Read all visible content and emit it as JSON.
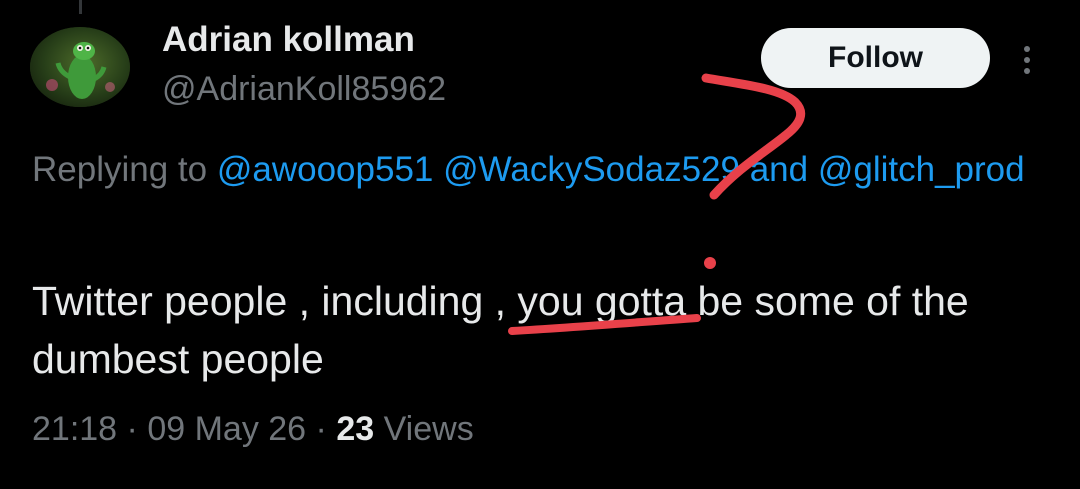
{
  "tweet": {
    "author": {
      "display_name": "Adrian kollman",
      "handle": "@AdrianKoll85962"
    },
    "follow_label": "Follow",
    "more_icon": "more-vertical-icon",
    "reply": {
      "prefix": "Replying to",
      "mention_1": "@awooop551",
      "mention_2": "@WackySodaz529",
      "conjunction": "and",
      "mention_3": "@glitch_prod"
    },
    "text": "Twitter people , including , you gotta be some of the dumbest people",
    "meta": {
      "time": "21:18",
      "date": "09 May 26",
      "views_count": "23",
      "views_label": "Views",
      "separator": "·"
    }
  },
  "colors": {
    "background": "#000000",
    "text_primary": "#e7e9ea",
    "text_secondary": "#71767b",
    "link": "#1d9bf0",
    "follow_bg": "#eff3f4",
    "annotation_red": "#e8414a"
  }
}
